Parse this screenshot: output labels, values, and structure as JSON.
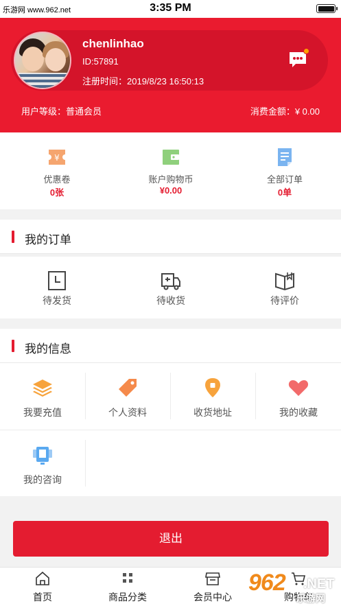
{
  "status_bar": {
    "carrier": "乐游网 www.962.net",
    "time": "3:35 PM"
  },
  "profile": {
    "username": "chenlinhao",
    "user_id": "ID:57891",
    "register_label": "注册时间：",
    "register_time": "2019/8/23 16:50:13",
    "level_label": "用户等级：",
    "level_value": "普通会员",
    "spend_label": "消费金额：",
    "spend_value": "¥ 0.00"
  },
  "stats": [
    {
      "label": "优惠卷",
      "value": "0张",
      "icon": "coupon-icon",
      "color": "#f5a56f"
    },
    {
      "label": "账户购物币",
      "value": "¥0.00",
      "icon": "wallet-icon",
      "color": "#8fd07c"
    },
    {
      "label": "全部订单",
      "value": "0单",
      "icon": "order-list-icon",
      "color": "#7ab4f0"
    }
  ],
  "my_orders": {
    "title": "我的订单",
    "items": [
      {
        "label": "待发货",
        "icon": "clock-icon"
      },
      {
        "label": "待收货",
        "icon": "truck-icon"
      },
      {
        "label": "待评价",
        "icon": "book-icon"
      }
    ]
  },
  "my_info": {
    "title": "我的信息",
    "items": [
      {
        "label": "我要充值",
        "icon": "layers-icon",
        "color": "#f7a33c"
      },
      {
        "label": "个人资料",
        "icon": "tag-icon",
        "color": "#f58a4b"
      },
      {
        "label": "收货地址",
        "icon": "location-shield-icon",
        "color": "#f7a33c"
      },
      {
        "label": "我的收藏",
        "icon": "heart-icon",
        "color": "#f26a6a"
      },
      {
        "label": "我的咨询",
        "icon": "chat-screen-icon",
        "color": "#5aa9f0"
      }
    ]
  },
  "logout_label": "退出",
  "tabbar": [
    {
      "label": "首页",
      "icon": "home-icon"
    },
    {
      "label": "商品分类",
      "icon": "grid-icon"
    },
    {
      "label": "会员中心",
      "icon": "store-icon"
    },
    {
      "label": "购物车",
      "icon": "cart-icon"
    }
  ],
  "watermark": {
    "brand": "962",
    "suffix": ".NET",
    "site": "乐游网"
  },
  "colors": {
    "brand_red": "#ea1b2f",
    "accent_red": "#e41c30",
    "badge_orange": "#ffa000"
  }
}
